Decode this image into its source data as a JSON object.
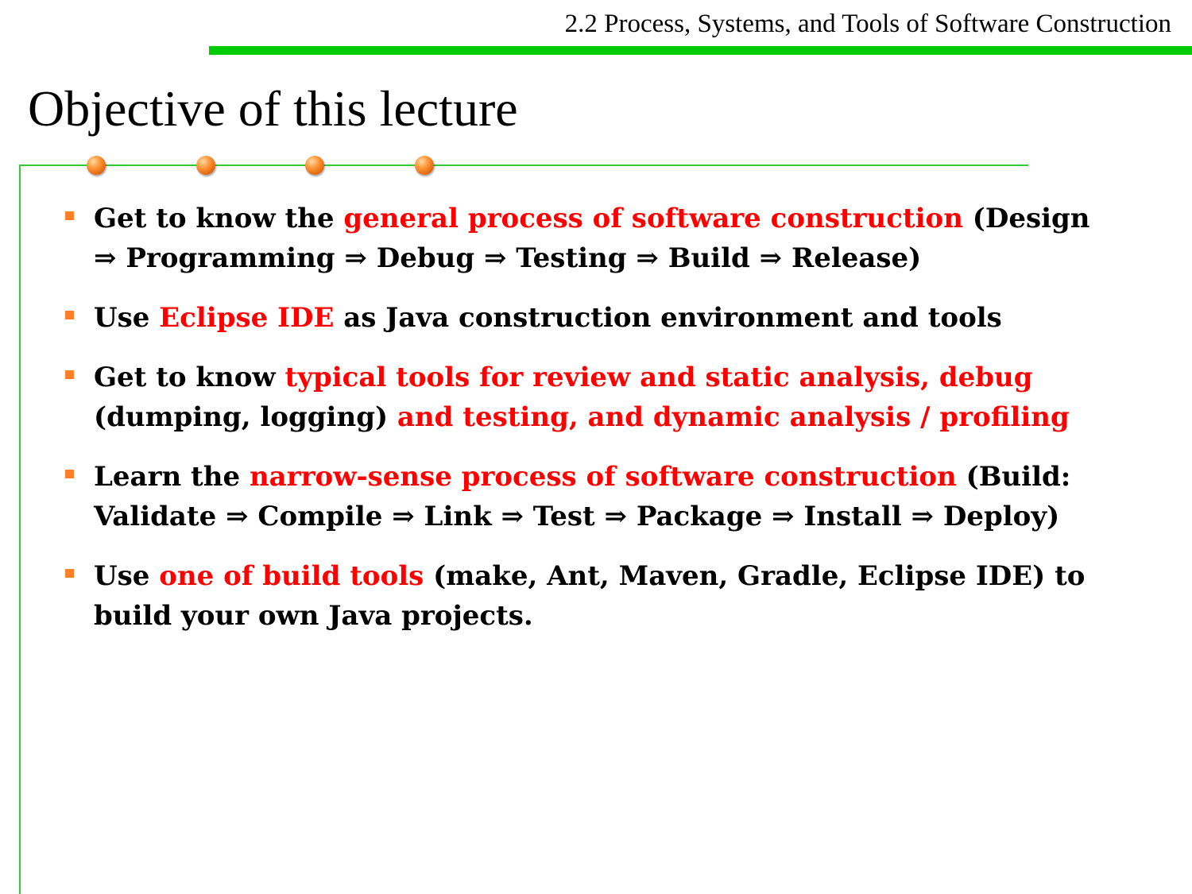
{
  "header": {
    "section_title": "2.2 Process, Systems, and Tools of Software Construction"
  },
  "slide": {
    "title": "Objective of this lecture"
  },
  "colors": {
    "accent_green": "#00cc00",
    "frame_green": "#33cc33",
    "bullet_orange": "#ff7f27",
    "highlight_red": "#ff0000"
  },
  "bullets": [
    {
      "parts": [
        {
          "text": "Get to know the ",
          "style": "black"
        },
        {
          "text": "general process of software construction",
          "style": "red"
        },
        {
          "text": " (Design ⇒ Programming ⇒ Debug ⇒ Testing ⇒ Build  ⇒ Release)",
          "style": "black"
        }
      ]
    },
    {
      "parts": [
        {
          "text": "Use ",
          "style": "black"
        },
        {
          "text": "Eclipse IDE",
          "style": "red"
        },
        {
          "text": " as Java construction environment and tools",
          "style": "black"
        }
      ]
    },
    {
      "parts": [
        {
          "text": "Get to know ",
          "style": "black"
        },
        {
          "text": "typical tools for review and static analysis, debug",
          "style": "red"
        },
        {
          "text": " (dumping, logging) ",
          "style": "black"
        },
        {
          "text": "and testing, and dynamic analysis / profiling",
          "style": "red"
        }
      ]
    },
    {
      "parts": [
        {
          "text": "Learn the ",
          "style": "black"
        },
        {
          "text": "narrow-sense process of software construction",
          "style": "red"
        },
        {
          "text": " (Build: Validate ⇒ Compile ⇒ Link ⇒ Test ⇒ Package ⇒ Install ⇒ Deploy)",
          "style": "black"
        }
      ]
    },
    {
      "parts": [
        {
          "text": "Use ",
          "style": "black"
        },
        {
          "text": "one of build tools",
          "style": "red"
        },
        {
          "text": " (make, Ant, Maven, Gradle, Eclipse IDE) to build your own Java projects.",
          "style": "black"
        }
      ]
    }
  ]
}
